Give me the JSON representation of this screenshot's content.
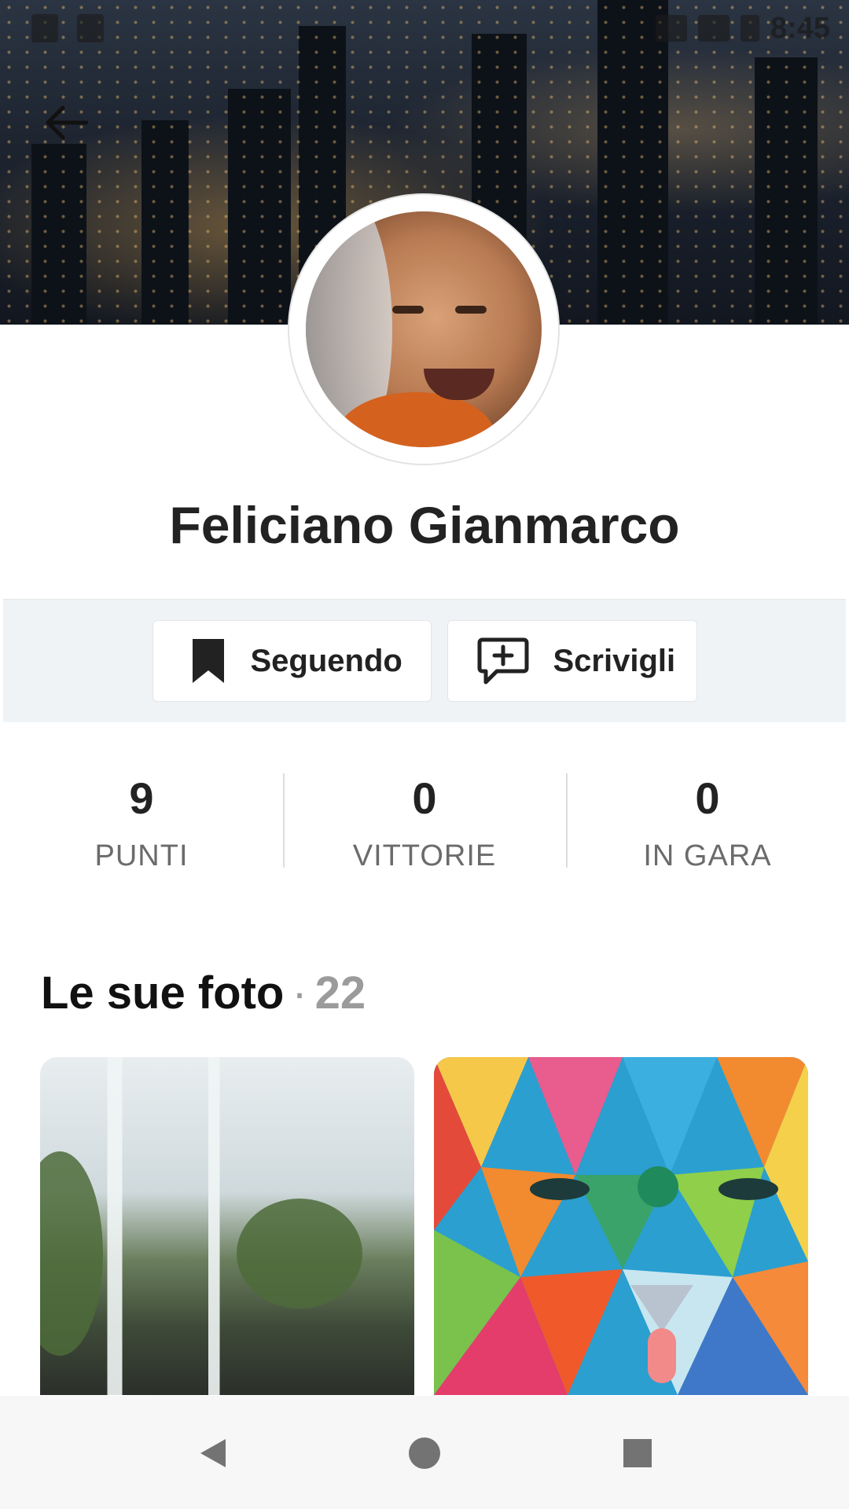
{
  "status_bar": {
    "time": "8:45"
  },
  "profile": {
    "name": "Feliciano Gianmarco"
  },
  "actions": {
    "follow_label": "Seguendo",
    "write_label": "Scrivigli"
  },
  "stats": [
    {
      "value": "9",
      "label": "PUNTI"
    },
    {
      "value": "0",
      "label": "VITTORIE"
    },
    {
      "value": "0",
      "label": "IN GARA"
    }
  ],
  "photos": {
    "title": "Le sue foto",
    "separator": "·",
    "count": "22"
  },
  "colors": {
    "band_bg": "#f0f3f6",
    "text": "#222222",
    "muted": "#9b9b9b"
  },
  "icons": [
    "arrow-left-icon",
    "bookmark-icon",
    "message-plus-icon",
    "nav-back-icon",
    "nav-home-icon",
    "nav-recents-icon"
  ]
}
